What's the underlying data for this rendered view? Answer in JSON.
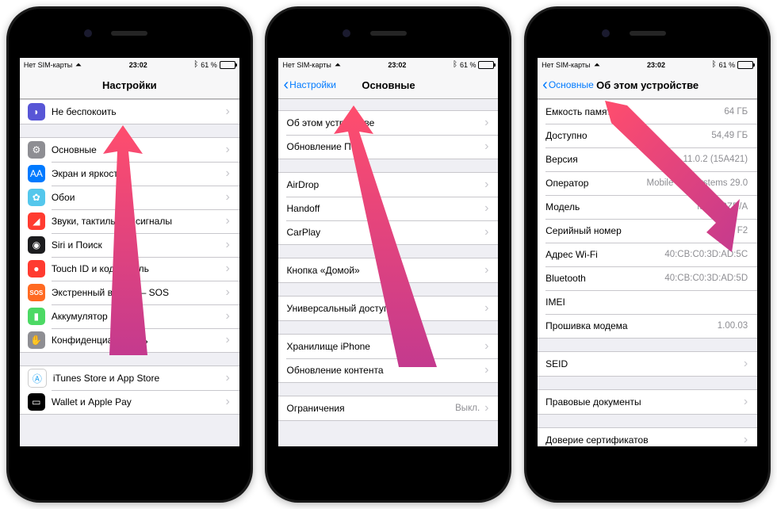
{
  "status": {
    "carrier": "Нет SIM-карты",
    "time": "23:02",
    "battery": "61 %"
  },
  "phone1": {
    "title": "Настройки",
    "groups": [
      {
        "rows": [
          {
            "icon": "moon",
            "label": "Не беспокоить"
          }
        ]
      },
      {
        "rows": [
          {
            "icon": "gear",
            "label": "Основные"
          },
          {
            "icon": "text",
            "label": "Экран и яркость"
          },
          {
            "icon": "wall",
            "label": "Обои"
          },
          {
            "icon": "snd",
            "label": "Звуки, тактильные сигналы"
          },
          {
            "icon": "siri",
            "label": "Siri и Поиск"
          },
          {
            "icon": "touch",
            "label": "Touch ID и код-пароль"
          },
          {
            "icon": "sos",
            "label": "Экстренный вызов — SOS"
          },
          {
            "icon": "bat",
            "label": "Аккумулятор"
          },
          {
            "icon": "priv",
            "label": "Конфиденциальность"
          }
        ]
      },
      {
        "rows": [
          {
            "icon": "store",
            "label": "iTunes Store и App Store"
          },
          {
            "icon": "wallet",
            "label": "Wallet и Apple Pay"
          }
        ]
      }
    ]
  },
  "phone2": {
    "title": "Основные",
    "back": "Настройки",
    "groups": [
      {
        "rows": [
          {
            "label": "Об этом устройстве"
          },
          {
            "label": "Обновление ПО"
          }
        ]
      },
      {
        "rows": [
          {
            "label": "AirDrop"
          },
          {
            "label": "Handoff"
          },
          {
            "label": "CarPlay"
          }
        ]
      },
      {
        "rows": [
          {
            "label": "Кнопка «Домой»"
          }
        ]
      },
      {
        "rows": [
          {
            "label": "Универсальный доступ"
          }
        ]
      },
      {
        "rows": [
          {
            "label": "Хранилище iPhone"
          },
          {
            "label": "Обновление контента"
          }
        ]
      },
      {
        "rows": [
          {
            "label": "Ограничения",
            "value": "Выкл."
          }
        ]
      }
    ]
  },
  "phone3": {
    "title": "Об этом устройстве",
    "back": "Основные",
    "rows": [
      {
        "label": "Емкость памяти",
        "value": "64 ГБ"
      },
      {
        "label": "Доступно",
        "value": "54,49 ГБ"
      },
      {
        "label": "Версия",
        "value": "11.0.2 (15A421)"
      },
      {
        "label": "Оператор",
        "value": "Mobile TeleSystems 29.0"
      },
      {
        "label": "Модель",
        "value": "MQ8L2ZD/A"
      },
      {
        "label": "Серийный номер",
        "value": "F2"
      },
      {
        "label": "Адрес Wi-Fi",
        "value": "40:CB:C0:3D:AD:5C"
      },
      {
        "label": "Bluetooth",
        "value": "40:CB:C0:3D:AD:5D"
      },
      {
        "label": "IMEI",
        "value": " "
      },
      {
        "label": "Прошивка модема",
        "value": "1.00.03"
      }
    ],
    "seid": "SEID",
    "legal": "Правовые документы",
    "trust": "Доверие сертификатов"
  }
}
